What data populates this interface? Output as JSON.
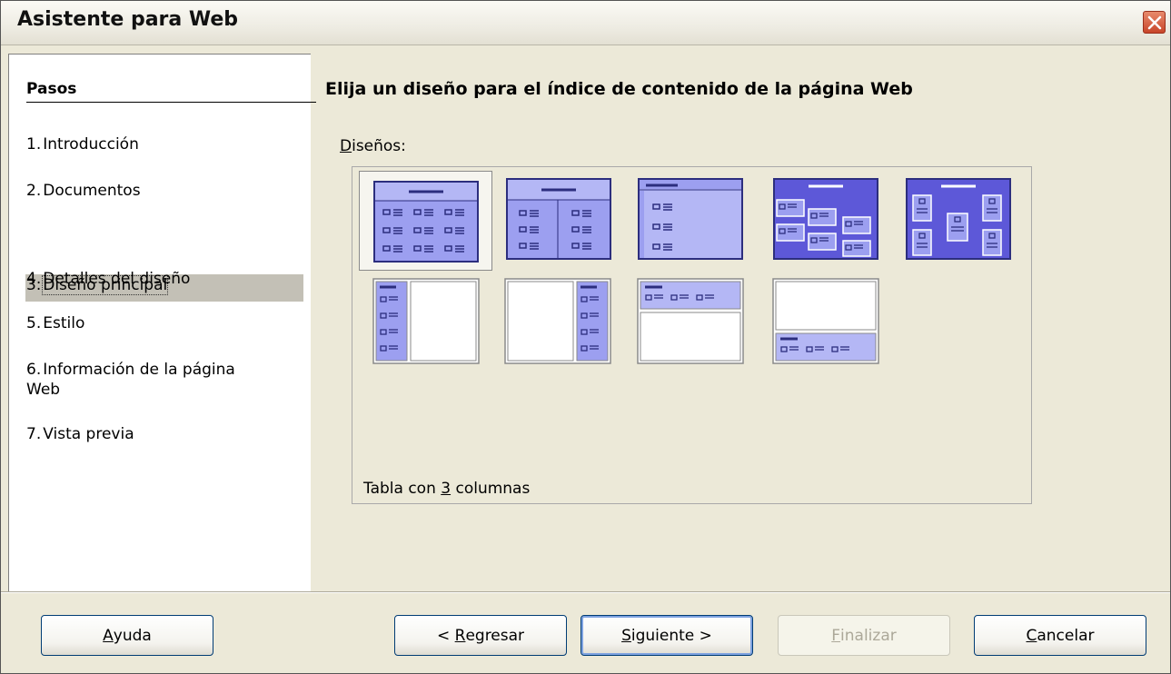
{
  "window": {
    "title": "Asistente para Web"
  },
  "sidebar": {
    "title": "Pasos",
    "steps": [
      {
        "num": "1.",
        "label": "Introducción"
      },
      {
        "num": "2.",
        "label": "Documentos"
      },
      {
        "num": "3.",
        "label": "Diseño principal",
        "active": true
      },
      {
        "num": "4.",
        "label": "Detalles del diseño"
      },
      {
        "num": "5.",
        "label": "Estilo"
      },
      {
        "num": "6.",
        "label": "Información de la página",
        "label2": "Web"
      },
      {
        "num": "7.",
        "label": "Vista previa"
      }
    ]
  },
  "main": {
    "title": "Elija un diseño para el índice de contenido de la página Web",
    "designs_label_mnemonic": "D",
    "designs_label_rest": "iseños:",
    "selected_description_pre": "Tabla con ",
    "selected_description_mnemonic": "3",
    "selected_description_post": " columnas",
    "layouts": [
      "table-3-columns",
      "table-2-columns",
      "simple",
      "diagonal",
      "zig-zag",
      "sidebar-left",
      "sidebar-right",
      "top-bar",
      "bottom-bar"
    ]
  },
  "buttons": {
    "help": {
      "mnemonic": "A",
      "rest": "yuda"
    },
    "back": {
      "pre": "< ",
      "mnemonic": "R",
      "rest": "egresar"
    },
    "next": {
      "mnemonic": "S",
      "rest": "iguiente >"
    },
    "finish": {
      "mnemonic": "F",
      "rest": "inalizar"
    },
    "cancel": {
      "mnemonic": "C",
      "rest": "ancelar"
    }
  },
  "colors": {
    "thumb_fill": "#9c9ff0",
    "thumb_dark": "#5d58d8",
    "thumb_border": "#2c2e7e"
  }
}
